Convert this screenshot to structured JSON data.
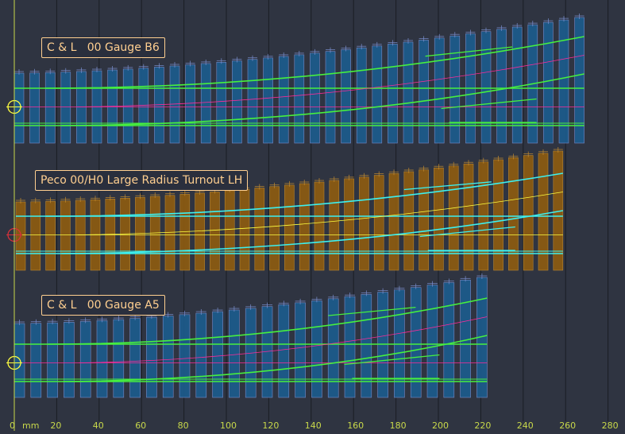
{
  "diagram": {
    "unit_label": "mm",
    "axis_ticks": [
      "0",
      "20",
      "40",
      "60",
      "80",
      "100",
      "120",
      "140",
      "160",
      "180",
      "200",
      "220",
      "240",
      "260",
      "280"
    ],
    "colors": {
      "background": "#2f3441",
      "grid": "#1a1d24",
      "axis": "#c8d84a",
      "rail_green": "#46f03e",
      "rail_cyan": "#3cf0f0",
      "timber_blue": "#1d5a8a",
      "timber_brown": "#8a5a12",
      "centreline_magenta": "#ff2a9a",
      "centreline_yellow": "#ffff40",
      "label_text": "#ffcf90"
    }
  },
  "templates": [
    {
      "name": "C & L   00 Gauge B6"
    },
    {
      "name": "Peco 00/H0 Large Radius Turnout LH"
    },
    {
      "name": "C & L   00 Gauge A5"
    }
  ]
}
